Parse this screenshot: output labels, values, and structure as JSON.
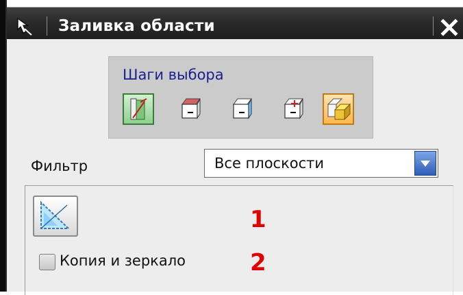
{
  "window": {
    "title": "Заливка области",
    "title_icon": "select-arrow-icon",
    "close_icon": "close-icon"
  },
  "selection_steps": {
    "label": "Шаги выбора",
    "steps": [
      {
        "icon": "target-body-icon",
        "active": true
      },
      {
        "icon": "top-face-icon"
      },
      {
        "icon": "side-face-icon"
      },
      {
        "icon": "add-face-icon"
      },
      {
        "icon": "box-body-icon",
        "highlighted": true
      }
    ]
  },
  "filter": {
    "label": "Фильтр",
    "value": "Все плоскости"
  },
  "tool_button": {
    "icon": "triangle-region-icon"
  },
  "annotations": {
    "one": "1",
    "two": "2"
  },
  "options": {
    "copy_mirror_label": "Копия и зеркало",
    "copy_mirror_checked": false
  },
  "colors": {
    "titlebar": "#2c2c2c",
    "dialog_bg": "#ededed",
    "accent_red": "#e00000",
    "steps_title": "#1a1f8f"
  }
}
